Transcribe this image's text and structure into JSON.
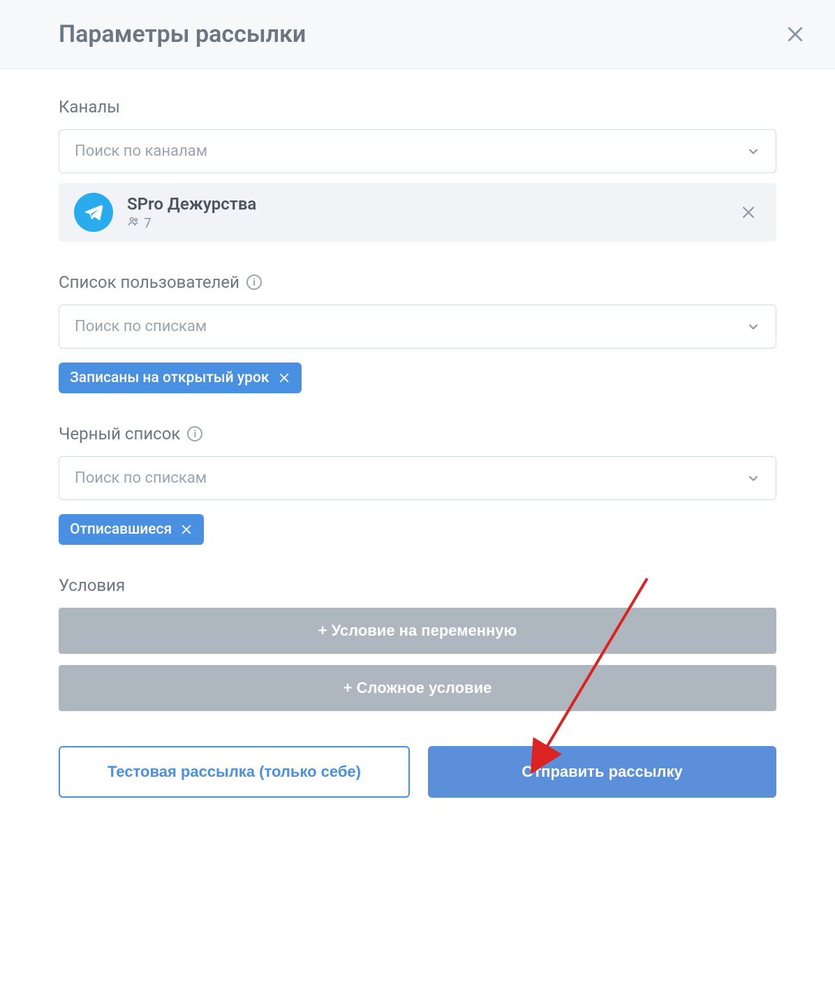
{
  "modal": {
    "title": "Параметры рассылки"
  },
  "channels": {
    "label": "Каналы",
    "placeholder": "Поиск по каналам",
    "selected": {
      "name": "SPro Дежурства",
      "members": "7"
    }
  },
  "userlist": {
    "label": "Список пользователей",
    "placeholder": "Поиск по спискам",
    "tag": "Записаны на открытый урок"
  },
  "blacklist": {
    "label": "Черный список",
    "placeholder": "Поиск по спискам",
    "tag": "Отписавшиеся"
  },
  "conditions": {
    "label": "Условия",
    "btn_variable": "+ Условие на переменную",
    "btn_complex": "+ Сложное условие"
  },
  "footer": {
    "test": "Тестовая рассылка (только себе)",
    "send": "Отправить рассылку"
  }
}
